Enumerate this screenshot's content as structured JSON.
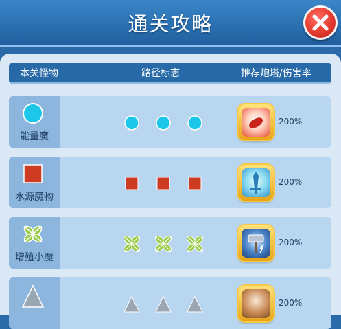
{
  "title": "通关攻略",
  "close_icon": "close-icon",
  "columns": {
    "monster": "本关怪物",
    "path": "路径标志",
    "tower": "推荐炮塔/伤害率"
  },
  "rows": [
    {
      "monster": "能量魔",
      "marker": "circle",
      "marker_color": "#1dc7ea",
      "tower_icon": "fire-tower-icon",
      "damage": "200%"
    },
    {
      "monster": "水源魔物",
      "marker": "square",
      "marker_color": "#cc3b22",
      "tower_icon": "ice-sword-tower-icon",
      "damage": "200%"
    },
    {
      "monster": "增殖小魔",
      "marker": "clover",
      "marker_color": "#9ccc4b",
      "tower_icon": "thunder-hammer-tower-icon",
      "damage": "200%"
    },
    {
      "monster": "",
      "marker": "triangle",
      "marker_color": "#9aa6b2",
      "tower_icon": "tower-icon",
      "damage": "200%"
    }
  ],
  "colors": {
    "header": "#2a6fb0",
    "panel": "#dbe9f7",
    "row": "#b8d6ef",
    "close": "#e53a2f"
  }
}
